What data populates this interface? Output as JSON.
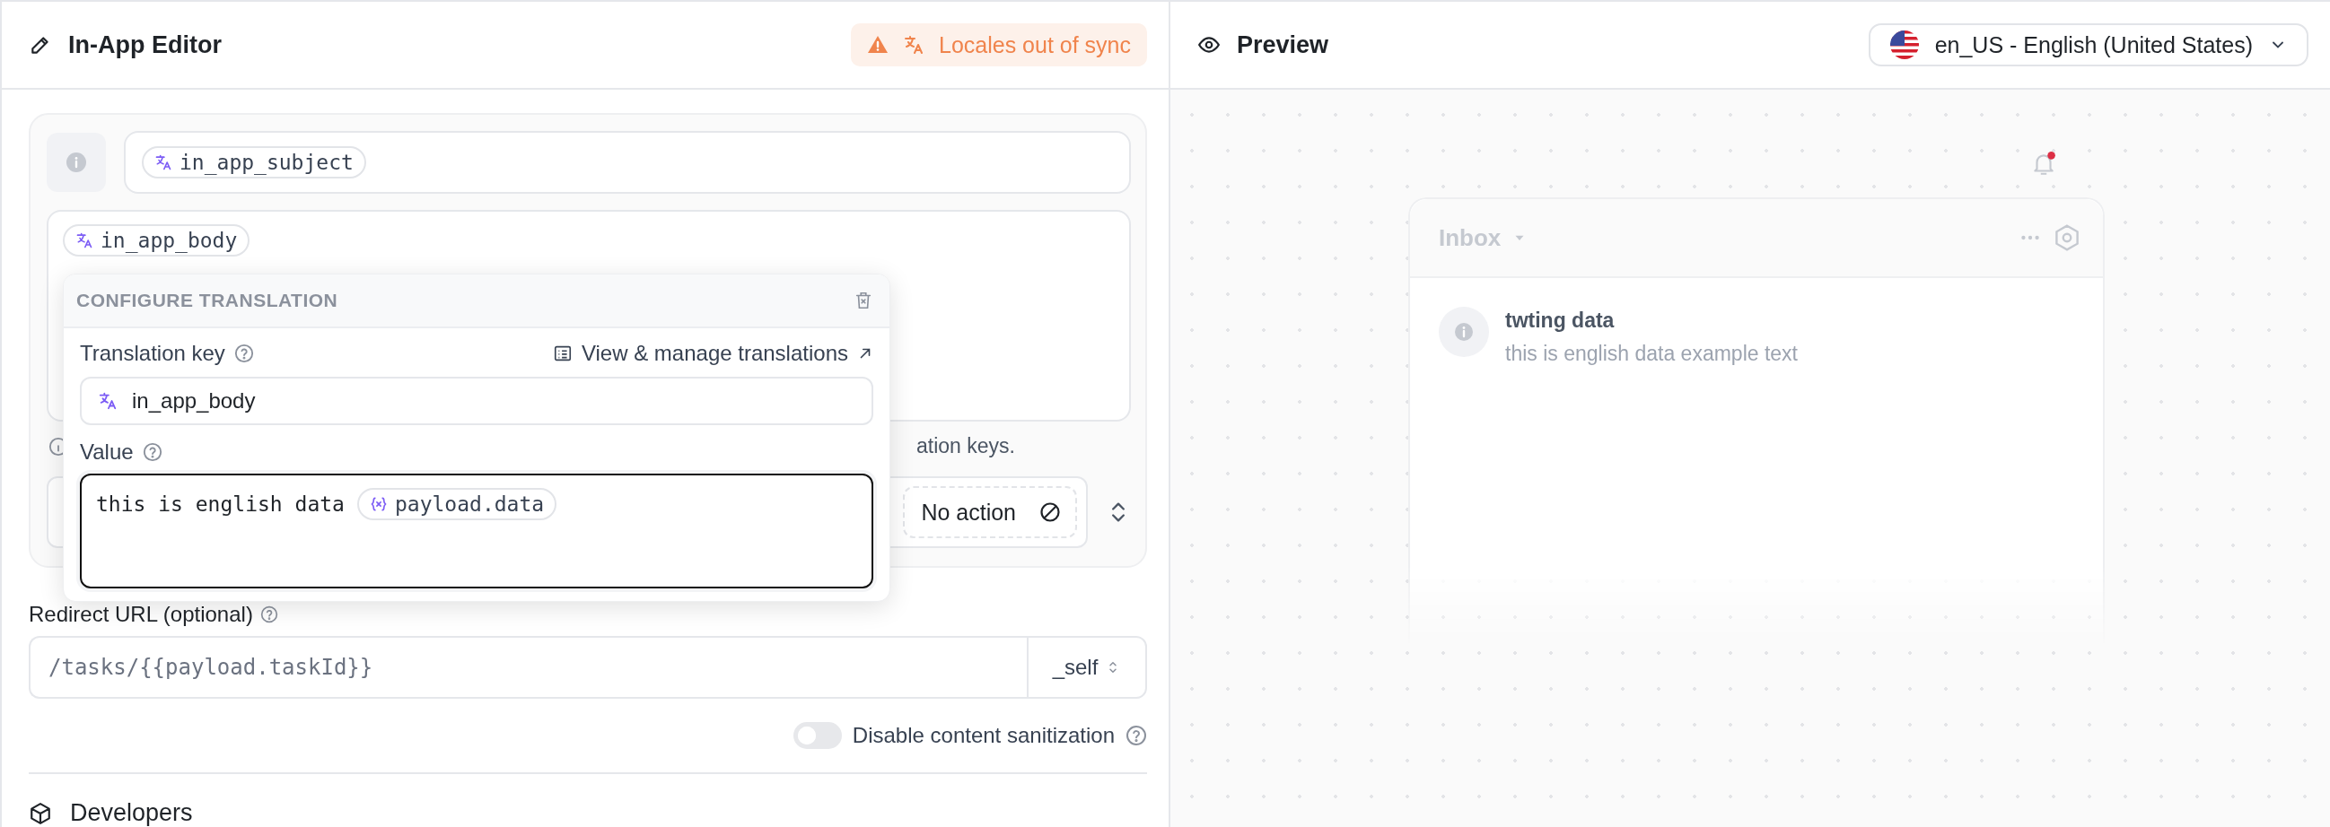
{
  "editor": {
    "title": "In-App Editor",
    "warning": "Locales out of sync",
    "subject": {
      "chip": "in_app_subject"
    },
    "body": {
      "chip": "in_app_body"
    },
    "helper_text": "ation keys.",
    "action": {
      "label": "No action"
    },
    "redirect": {
      "label": "Redirect URL (optional)",
      "value": "/tasks/{{payload.taskId}}",
      "target": "_self"
    },
    "sanitization": {
      "label": "Disable content sanitization",
      "on": false
    },
    "developers": "Developers"
  },
  "translation_popover": {
    "title": "CONFIGURE TRANSLATION",
    "key_label": "Translation key",
    "manage_link": "View & manage translations",
    "key": "in_app_body",
    "value_label": "Value",
    "value_text": "this is english data",
    "variable": "payload.data"
  },
  "preview": {
    "title": "Preview",
    "locale": "en_US - English (United States)",
    "unread": true,
    "inbox": {
      "title": "Inbox",
      "items": [
        {
          "title": "twting data",
          "body": "this is english data example text"
        }
      ]
    }
  }
}
